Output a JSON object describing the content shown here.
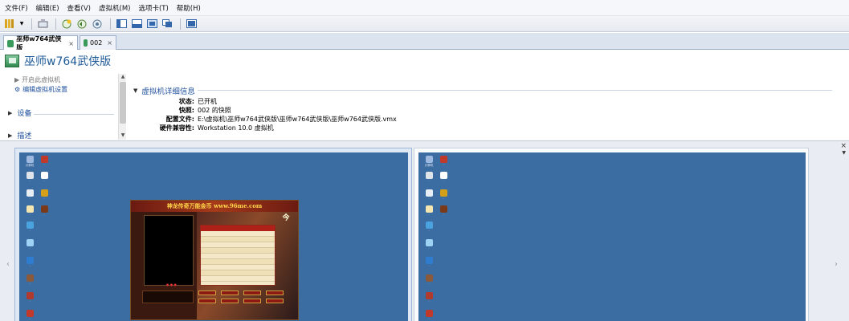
{
  "menu": [
    "文件(F)",
    "编辑(E)",
    "查看(V)",
    "虚拟机(M)",
    "选项卡(T)",
    "帮助(H)"
  ],
  "toolbar": {
    "icons": [
      "library-icon",
      "dropdown-icon",
      "send-keys-icon",
      "snapshot-icon",
      "revert-snapshot-icon",
      "snapshot-manager-icon",
      "normal-view-icon",
      "console-view-icon",
      "fullscreen-icon",
      "unity-icon",
      "thumbnail-bar-icon"
    ]
  },
  "tabs": [
    {
      "label": "巫师w764武侠版",
      "close": "×",
      "active": true
    },
    {
      "label": "002",
      "close": "×",
      "active": false
    }
  ],
  "vm": {
    "title": "巫师w764武侠版"
  },
  "commands": {
    "power_on": "开启此虚拟机",
    "edit_settings": "编辑虚拟机设置",
    "devices": "设备",
    "description": "描述"
  },
  "details": {
    "title": "虚拟机详细信息",
    "rows": [
      {
        "label": "状态:",
        "value": "已开机"
      },
      {
        "label": "快照:",
        "value": "002 的快照"
      },
      {
        "label": "配置文件:",
        "value": "E:\\虚拟机\\巫师w764武侠版\\巫师w764武侠版\\巫师w764武侠版.vmx"
      },
      {
        "label": "硬件兼容性:",
        "value": "Workstation 10.0 虚拟机"
      }
    ]
  },
  "thumbnails": {
    "close": "×",
    "game_banner": "神龙传奇万能金币 www.96me.com",
    "game_badge": "今"
  }
}
